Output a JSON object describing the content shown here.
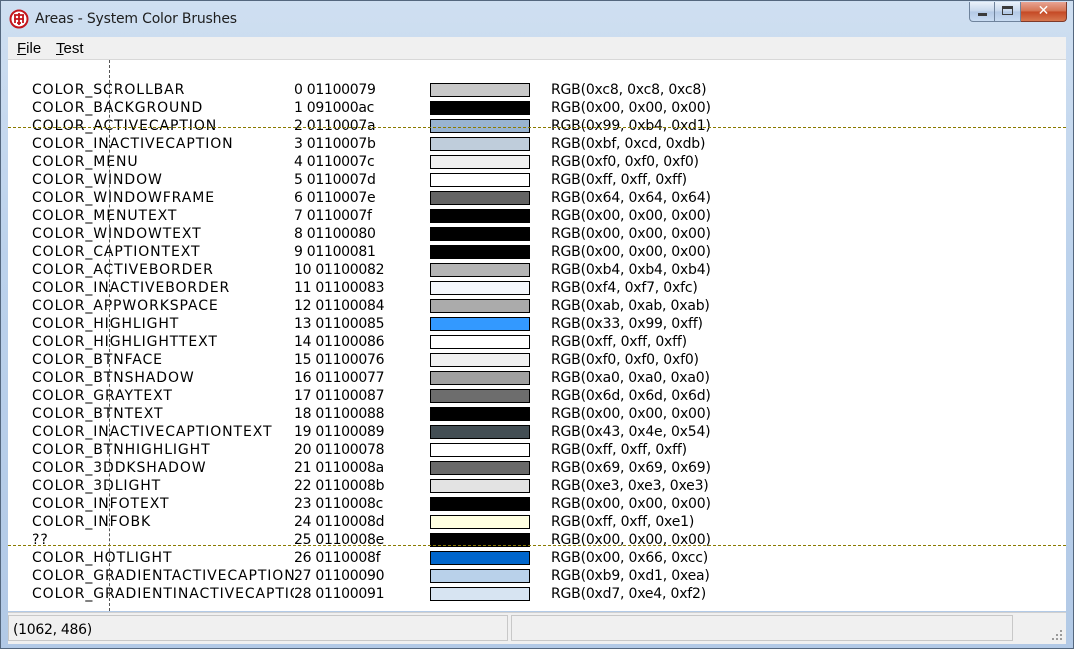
{
  "window": {
    "title": "Areas - System Color Brushes"
  },
  "icons": {
    "app": "app-icon",
    "minimize": "minimize-icon",
    "maximize": "maximize-icon",
    "close": "close-icon",
    "grip": "size-grip-icon"
  },
  "caption_buttons": {
    "close_label": "✕"
  },
  "menu": {
    "file": {
      "underline": "F",
      "rest": "ile"
    },
    "test": {
      "underline": "T",
      "rest": "est"
    }
  },
  "rows": [
    {
      "name": "COLOR_SCROLLBAR",
      "idx": "0 01100079",
      "color": "#c8c8c8",
      "rgb": "RGB(0xc8, 0xc8, 0xc8)"
    },
    {
      "name": "COLOR_BACKGROUND",
      "idx": "1 091000ac",
      "color": "#000000",
      "rgb": "RGB(0x00, 0x00, 0x00)"
    },
    {
      "name": "COLOR_ACTIVECAPTION",
      "idx": "2 0110007a",
      "color": "#99b4d1",
      "rgb": "RGB(0x99, 0xb4, 0xd1)"
    },
    {
      "name": "COLOR_INACTIVECAPTION",
      "idx": "3 0110007b",
      "color": "#bfcddb",
      "rgb": "RGB(0xbf, 0xcd, 0xdb)"
    },
    {
      "name": "COLOR_MENU",
      "idx": "4 0110007c",
      "color": "#f0f0f0",
      "rgb": "RGB(0xf0, 0xf0, 0xf0)"
    },
    {
      "name": "COLOR_WINDOW",
      "idx": "5 0110007d",
      "color": "#ffffff",
      "rgb": "RGB(0xff, 0xff, 0xff)"
    },
    {
      "name": "COLOR_WINDOWFRAME",
      "idx": "6 0110007e",
      "color": "#646464",
      "rgb": "RGB(0x64, 0x64, 0x64)"
    },
    {
      "name": "COLOR_MENUTEXT",
      "idx": "7 0110007f",
      "color": "#000000",
      "rgb": "RGB(0x00, 0x00, 0x00)"
    },
    {
      "name": "COLOR_WINDOWTEXT",
      "idx": "8 01100080",
      "color": "#000000",
      "rgb": "RGB(0x00, 0x00, 0x00)"
    },
    {
      "name": "COLOR_CAPTIONTEXT",
      "idx": "9 01100081",
      "color": "#000000",
      "rgb": "RGB(0x00, 0x00, 0x00)"
    },
    {
      "name": "COLOR_ACTIVEBORDER",
      "idx": "10 01100082",
      "color": "#b4b4b4",
      "rgb": "RGB(0xb4, 0xb4, 0xb4)"
    },
    {
      "name": "COLOR_INACTIVEBORDER",
      "idx": "11 01100083",
      "color": "#f4f7fc",
      "rgb": "RGB(0xf4, 0xf7, 0xfc)"
    },
    {
      "name": "COLOR_APPWORKSPACE",
      "idx": "12 01100084",
      "color": "#ababab",
      "rgb": "RGB(0xab, 0xab, 0xab)"
    },
    {
      "name": "COLOR_HIGHLIGHT",
      "idx": "13 01100085",
      "color": "#3399ff",
      "rgb": "RGB(0x33, 0x99, 0xff)"
    },
    {
      "name": "COLOR_HIGHLIGHTTEXT",
      "idx": "14 01100086",
      "color": "#ffffff",
      "rgb": "RGB(0xff, 0xff, 0xff)"
    },
    {
      "name": "COLOR_BTNFACE",
      "idx": "15 01100076",
      "color": "#f0f0f0",
      "rgb": "RGB(0xf0, 0xf0, 0xf0)"
    },
    {
      "name": "COLOR_BTNSHADOW",
      "idx": "16 01100077",
      "color": "#a0a0a0",
      "rgb": "RGB(0xa0, 0xa0, 0xa0)"
    },
    {
      "name": "COLOR_GRAYTEXT",
      "idx": "17 01100087",
      "color": "#6d6d6d",
      "rgb": "RGB(0x6d, 0x6d, 0x6d)"
    },
    {
      "name": "COLOR_BTNTEXT",
      "idx": "18 01100088",
      "color": "#000000",
      "rgb": "RGB(0x00, 0x00, 0x00)"
    },
    {
      "name": "COLOR_INACTIVECAPTIONTEXT",
      "idx": "19 01100089",
      "color": "#434e54",
      "rgb": "RGB(0x43, 0x4e, 0x54)"
    },
    {
      "name": "COLOR_BTNHIGHLIGHT",
      "idx": "20 01100078",
      "color": "#ffffff",
      "rgb": "RGB(0xff, 0xff, 0xff)"
    },
    {
      "name": "COLOR_3DDKSHADOW",
      "idx": "21 0110008a",
      "color": "#696969",
      "rgb": "RGB(0x69, 0x69, 0x69)"
    },
    {
      "name": "COLOR_3DLIGHT",
      "idx": "22 0110008b",
      "color": "#e3e3e3",
      "rgb": "RGB(0xe3, 0xe3, 0xe3)"
    },
    {
      "name": "COLOR_INFOTEXT",
      "idx": "23 0110008c",
      "color": "#000000",
      "rgb": "RGB(0x00, 0x00, 0x00)"
    },
    {
      "name": "COLOR_INFOBK",
      "idx": "24 0110008d",
      "color": "#ffffe1",
      "rgb": "RGB(0xff, 0xff, 0xe1)"
    },
    {
      "name": "??",
      "idx": "25 0110008e",
      "color": "#000000",
      "rgb": "RGB(0x00, 0x00, 0x00)"
    },
    {
      "name": "COLOR_HOTLIGHT",
      "idx": "26 0110008f",
      "color": "#0066cc",
      "rgb": "RGB(0x00, 0x66, 0xcc)"
    },
    {
      "name": "COLOR_GRADIENTACTIVECAPTION",
      "idx": "27 01100090",
      "color": "#b9d1ea",
      "rgb": "RGB(0xb9, 0xd1, 0xea)"
    },
    {
      "name": "COLOR_GRADIENTINACTIVECAPTION",
      "idx": "28 01100091",
      "color": "#d7e4f2",
      "rgb": "RGB(0xd7, 0xe4, 0xf2)"
    }
  ],
  "status": {
    "coords": "(1062, 486)",
    "pane2": ""
  }
}
